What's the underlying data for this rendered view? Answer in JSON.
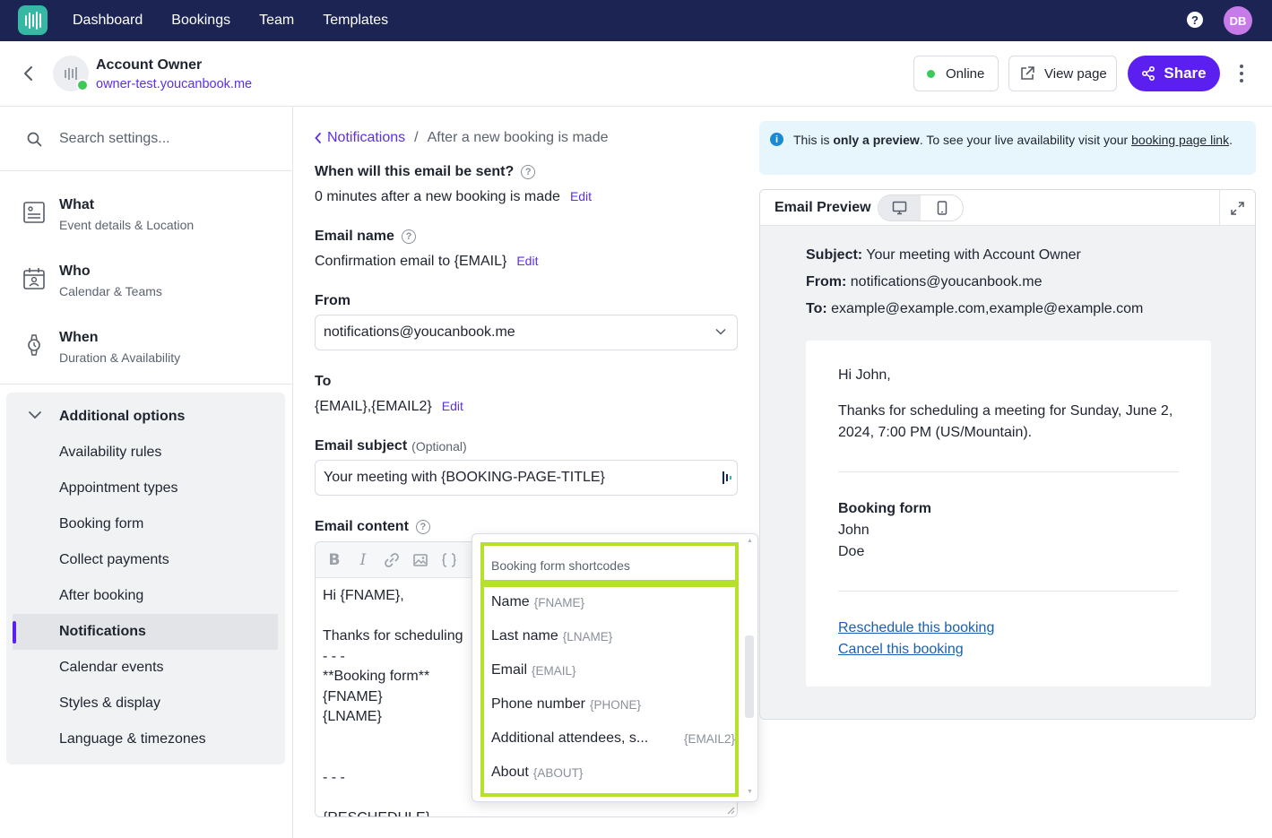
{
  "topnav": {
    "links": [
      "Dashboard",
      "Bookings",
      "Team",
      "Templates"
    ],
    "help_label": "?",
    "avatar_initials": "DB"
  },
  "header": {
    "account_name": "Account Owner",
    "account_url": "owner-test.youcanbook.me",
    "online_label": "Online",
    "view_page_label": "View page",
    "share_label": "Share"
  },
  "sidebar": {
    "search_placeholder": "Search settings...",
    "sections": [
      {
        "title": "What",
        "subtitle": "Event details & Location",
        "icon": "document-icon"
      },
      {
        "title": "Who",
        "subtitle": "Calendar & Teams",
        "icon": "calendar-person-icon"
      },
      {
        "title": "When",
        "subtitle": "Duration & Availability",
        "icon": "watch-icon"
      }
    ],
    "additional_label": "Additional options",
    "additional_items": [
      "Availability rules",
      "Appointment types",
      "Booking form",
      "Collect payments",
      "After booking",
      "Notifications",
      "Calendar events",
      "Styles & display",
      "Language & timezones"
    ],
    "active_item": "Notifications"
  },
  "form": {
    "breadcrumb_link": "Notifications",
    "breadcrumb_sep": "/",
    "breadcrumb_current": "After a new booking is made",
    "when_label": "When will this email be sent?",
    "when_value": "0 minutes after a new booking is made",
    "email_name_label": "Email name",
    "email_name_value": "Confirmation email to {EMAIL}",
    "from_label": "From",
    "from_value": "notifications@youcanbook.me",
    "to_label": "To",
    "to_value": "{EMAIL},{EMAIL2}",
    "subject_label": "Email subject",
    "subject_optional": "(Optional)",
    "subject_value": "Your meeting with {BOOKING-PAGE-TITLE}",
    "content_label": "Email content",
    "edit_label": "Edit",
    "help_glyph": "?",
    "content_body": "Hi {FNAME},\n\nThanks for scheduling\n- - -\n**Booking form**\n{FNAME}\n{LNAME}\n\n\n- - -\n\n{RESCHEDULE}"
  },
  "shortcodes": {
    "header": "Booking form shortcodes",
    "items": [
      {
        "label": "Name",
        "code": "{FNAME}"
      },
      {
        "label": "Last name",
        "code": "{LNAME}"
      },
      {
        "label": "Email",
        "code": "{EMAIL}"
      },
      {
        "label": "Phone number",
        "code": "{PHONE}"
      },
      {
        "label": "Additional attendees, s...",
        "code": "{EMAIL2}"
      },
      {
        "label": "About",
        "code": "{ABOUT}"
      }
    ]
  },
  "preview": {
    "info_prefix": "This is ",
    "info_bold": "only a preview",
    "info_middle": ". To see your live availability visit your ",
    "info_link": "booking page link",
    "info_suffix": ".",
    "info_glyph": "i",
    "title": "Email Preview",
    "subject_key": "Subject:",
    "subject_val": "Your meeting with Account Owner",
    "from_key": "From:",
    "from_val": "notifications@youcanbook.me",
    "to_key": "To:",
    "to_val": "example@example.com,example@example.com",
    "greeting": "Hi John,",
    "thanks_line1": "Thanks for scheduling a meeting for Sunday, June 2,",
    "thanks_line2": "2024, 7:00 PM (US/Mountain).",
    "form_heading": "Booking form",
    "first_name": "John",
    "last_name": "Doe",
    "reschedule_link": "Reschedule this booking",
    "cancel_link": "Cancel this booking"
  },
  "colors": {
    "nav_bg": "#1c2453",
    "accent": "#5b1ff0",
    "highlight": "#b5e02c",
    "online": "#3dc95a"
  }
}
